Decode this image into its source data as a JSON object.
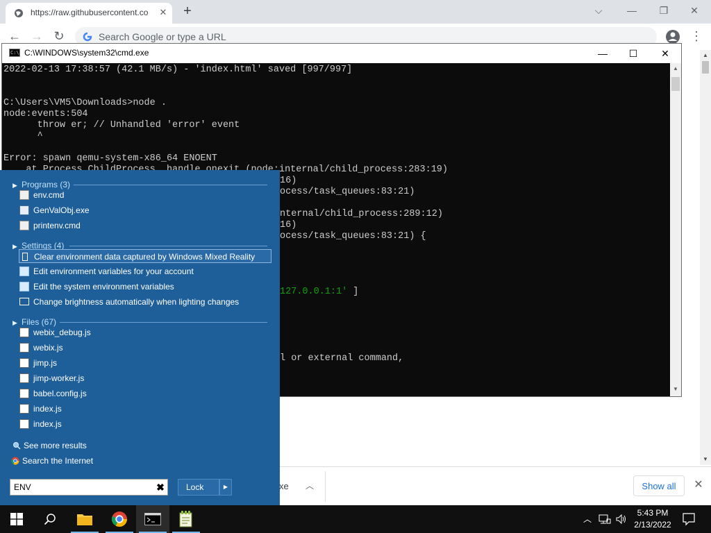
{
  "chrome": {
    "tab_title": "https://raw.githubusercontent.co",
    "tab_close": "✕",
    "new_tab": "+",
    "omnibox_placeholder": "Search Google or type a URL",
    "nav": {
      "back": "←",
      "forward": "→",
      "reload": "↻"
    },
    "window_controls": {
      "minimize": "⌵",
      "minimize2": "—",
      "restore": "❐",
      "close": "✕"
    },
    "menu": "⋮",
    "scroll_up": "▲",
    "scroll_down": "▼"
  },
  "download_bar": {
    "file_ext": "xe",
    "caret": "︿",
    "show_all": "Show all",
    "close": "✕"
  },
  "cmd": {
    "title": "C:\\WINDOWS\\system32\\cmd.exe",
    "icon_text": "C:\\",
    "controls": {
      "minimize": "—",
      "maximize": "☐",
      "close": "✕"
    },
    "lines": [
      "2022-02-13 17:38:57 (42.1 MB/s) - 'index.html' saved [997/997]",
      "",
      "",
      "C:\\Users\\VM5\\Downloads>node .",
      "node:events:504",
      "      throw er; // Unhandled 'error' event",
      "      ^",
      "",
      "Error: spawn qemu-system-x86_64 ENOENT",
      "    at Process.ChildProcess._handle.onexit (node:internal/child_process:283:19)"
    ],
    "partial_lines": [
      {
        "text": "16)",
        "row": 10
      },
      {
        "text": "ocess/task_queues:83:21)",
        "row": 11
      },
      {
        "text": "nternal/child_process:289:12)",
        "row": 13
      },
      {
        "text": "16)",
        "row": 14
      },
      {
        "text": "ocess/task_queues:83:21) {",
        "row": 15
      },
      {
        "text": "127.0.0.1:1'",
        "row": 20,
        "green": true
      },
      {
        "text": " ]",
        "row": 20,
        "after_green": true
      },
      {
        "text": "l or external command,",
        "row": 26
      }
    ],
    "scroll_up": "▲",
    "scroll_down": "▼"
  },
  "start_menu": {
    "sections": [
      {
        "header": "Programs (3)",
        "items": [
          {
            "label": "env.cmd",
            "icon": "cmd-file-icon"
          },
          {
            "label": "GenValObj.exe",
            "icon": "exe-file-icon"
          },
          {
            "label": "printenv.cmd",
            "icon": "cmd-file-icon"
          }
        ]
      },
      {
        "header": "Settings (4)",
        "items": [
          {
            "label": "Clear environment data captured by Windows Mixed Reality",
            "icon": "box-icon",
            "selected": true
          },
          {
            "label": "Edit environment variables for your account",
            "icon": "settings-icon"
          },
          {
            "label": "Edit the system environment variables",
            "icon": "settings-icon"
          },
          {
            "label": "Change brightness automatically when lighting changes",
            "icon": "monitor-icon"
          }
        ]
      },
      {
        "header": "Files (67)",
        "items": [
          {
            "label": "webix_debug.js",
            "icon": "js-file-icon"
          },
          {
            "label": "webix.js",
            "icon": "js-file-icon"
          },
          {
            "label": "jimp.js",
            "icon": "js-file-icon"
          },
          {
            "label": "jimp-worker.js",
            "icon": "js-file-icon"
          },
          {
            "label": "babel.config.js",
            "icon": "js-file-icon"
          },
          {
            "label": "index.js",
            "icon": "js-file-icon"
          },
          {
            "label": "index.js",
            "icon": "js-file-icon"
          }
        ]
      }
    ],
    "see_more": "See more results",
    "search_internet": "Search the Internet",
    "search_value": "ENV",
    "clear_icon": "✖",
    "lock_label": "Lock",
    "lock_arrow": "▶"
  },
  "taskbar": {
    "tray_chevron": "︿",
    "time": "5:43 PM",
    "date": "2/13/2022",
    "colors": {
      "background": "#101010",
      "accent": "#76b9ed"
    }
  },
  "colors": {
    "start_menu_bg": "#1f5f99",
    "cmd_bg": "#0c0c0c",
    "cmd_text": "#cccccc",
    "cmd_green": "#13a10e"
  }
}
